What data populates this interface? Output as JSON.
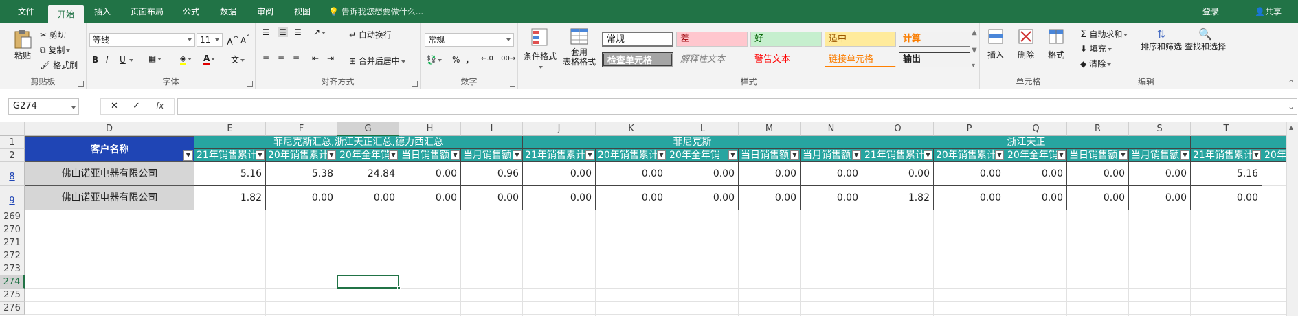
{
  "ribbon_tabs": [
    "文件",
    "开始",
    "插入",
    "页面布局",
    "公式",
    "数据",
    "审阅",
    "视图"
  ],
  "tell_me": "告诉我您想要做什么...",
  "login": "登录",
  "share": "共享",
  "clipboard": {
    "paste": "粘贴",
    "cut": "剪切",
    "copy": "复制",
    "format_painter": "格式刷",
    "label": "剪贴板"
  },
  "font": {
    "name": "等线",
    "size": "11",
    "label": "字体",
    "bold": "B",
    "italic": "I",
    "underline": "U"
  },
  "alignment": {
    "wrap": "自动换行",
    "merge": "合并后居中",
    "label": "对齐方式"
  },
  "number": {
    "format": "常规",
    "percent": "%",
    "comma": ",",
    "label": "数字"
  },
  "styles": {
    "conditional": "条件格式",
    "table_format_1": "套用",
    "table_format_2": "表格格式",
    "items": [
      "常规",
      "差",
      "好",
      "适中",
      "计算",
      "检查单元格",
      "解释性文本",
      "警告文本",
      "链接单元格",
      "输出"
    ],
    "label": "样式"
  },
  "cells": {
    "insert": "插入",
    "delete": "删除",
    "format": "格式",
    "label": "单元格"
  },
  "editing": {
    "autosum": "自动求和",
    "fill": "填充",
    "clear": "清除",
    "sort": "排序和筛选",
    "find": "查找和选择",
    "label": "编辑"
  },
  "formula_bar": {
    "name_box": "G274",
    "cancel": "✕",
    "enter": "✓",
    "fx": "fx",
    "value": ""
  },
  "columns": [
    "D",
    "E",
    "F",
    "G",
    "H",
    "I",
    "J",
    "K",
    "L",
    "M",
    "N",
    "O",
    "P",
    "Q",
    "R",
    "S",
    "T"
  ],
  "rows": [
    "1",
    "2",
    "8",
    "9",
    "269",
    "270",
    "271",
    "272",
    "273",
    "274",
    "275",
    "276"
  ],
  "header": {
    "customer": "客户名称",
    "groups": [
      "菲尼克斯汇总,浙江天正汇总,德力西汇总",
      "菲尼克斯",
      "浙江天正"
    ],
    "subheaders": [
      "21年销售累计",
      "20年销售累计",
      "20年全年销",
      "当日销售额",
      "当月销售额"
    ]
  },
  "data_rows": [
    {
      "customer": "佛山诺亚电器有限公司",
      "values": [
        "5.16",
        "5.38",
        "24.84",
        "0.00",
        "0.96",
        "0.00",
        "0.00",
        "0.00",
        "0.00",
        "0.00",
        "0.00",
        "0.00",
        "0.00",
        "0.00",
        "0.00",
        "5.16"
      ]
    },
    {
      "customer": "佛山诺亚电器有限公司",
      "values": [
        "1.82",
        "0.00",
        "0.00",
        "0.00",
        "0.00",
        "0.00",
        "0.00",
        "0.00",
        "0.00",
        "0.00",
        "1.82",
        "0.00",
        "0.00",
        "0.00",
        "0.00",
        "0.00"
      ]
    }
  ],
  "colors": {
    "accent": "#217346",
    "teal": "#27a5a0",
    "navy": "#1f45b5",
    "label_bg": "#d6d6d6"
  }
}
